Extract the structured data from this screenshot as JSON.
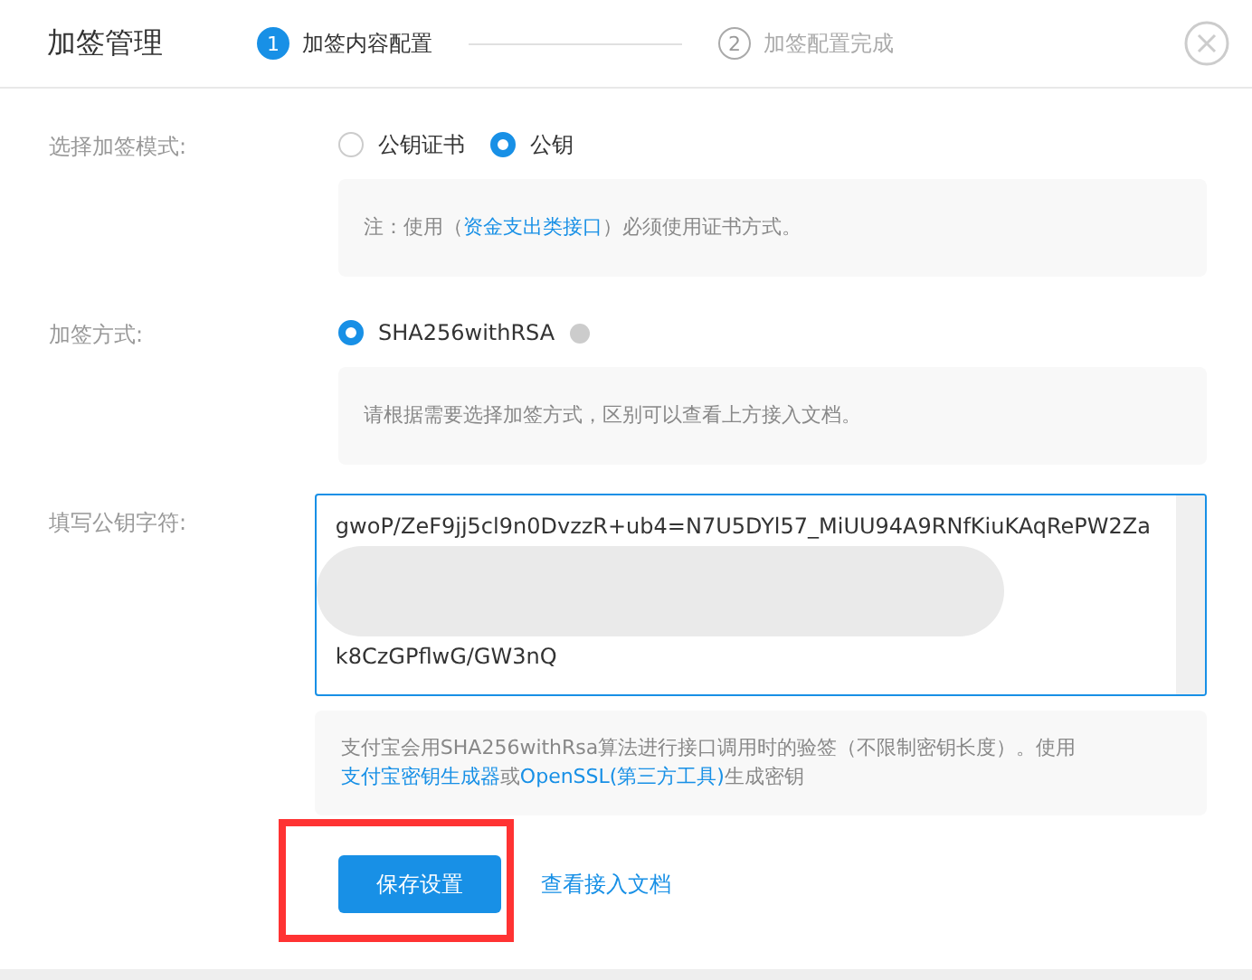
{
  "header": {
    "title": "加签管理",
    "steps": [
      {
        "number": "1",
        "label": "加签内容配置",
        "selected": true
      },
      {
        "number": "2",
        "label": "加签配置完成",
        "selected": false
      }
    ]
  },
  "form": {
    "rows": [
      {
        "kind": "radio",
        "label": "选择加签模式:",
        "options": [
          {
            "label": "公钥证书",
            "selected": false,
            "help": false
          },
          {
            "label": "公钥",
            "selected": true,
            "help": false
          }
        ],
        "note": [
          {
            "text": "注：使用（",
            "link": false
          },
          {
            "text": "资金支出类接口",
            "link": true
          },
          {
            "text": "）必须使用证书方式。",
            "link": false
          }
        ]
      },
      {
        "kind": "radio",
        "label": "加签方式:",
        "options": [
          {
            "label": "SHA256withRSA",
            "selected": true,
            "help": true
          }
        ],
        "note": [
          {
            "text": "请根据需要选择加签方式，区别可以查看上方接入文档。",
            "link": false
          }
        ]
      },
      {
        "kind": "textarea",
        "label": "填写公钥字符:",
        "lines": [
          "gwoP/ZeF9jj5cl9n0DvzzR+ub4=N7U5DYl57_MiUU94A9RNfKiuKAqRePW2Za",
          "k8CzGPflwG/GW3nQ"
        ],
        "redacted": true,
        "note": [
          {
            "text": "支付宝会用SHA256withRsa算法进行接口调用时的验签（不限制密钥长度）。使用",
            "link": false
          },
          {
            "text": "支付宝密钥生成器",
            "link": true
          },
          {
            "text": "或",
            "link": false
          },
          {
            "text": "OpenSSL(第三方工具)",
            "link": true
          },
          {
            "text": "生成密钥",
            "link": false
          }
        ]
      }
    ]
  },
  "actions": {
    "save": "保存设置",
    "doc_link": "查看接入文档",
    "highlighted": true
  }
}
